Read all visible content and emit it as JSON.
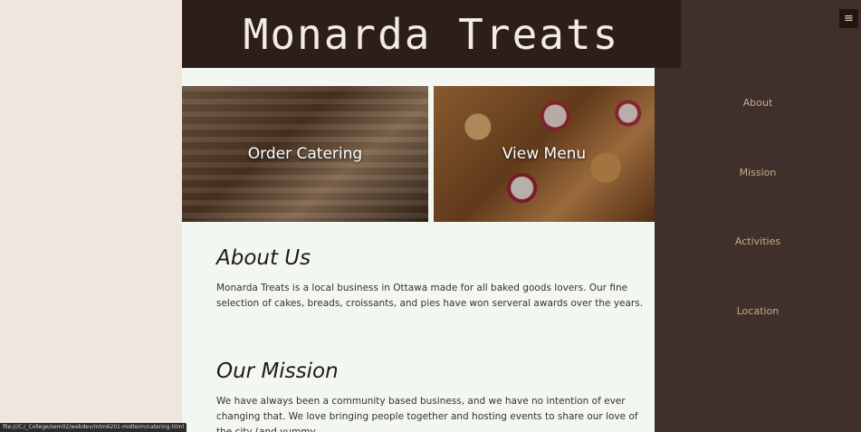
{
  "header": {
    "title": "Monarda Treats"
  },
  "tiles": [
    {
      "label": "Order Catering"
    },
    {
      "label": "View Menu"
    }
  ],
  "about": {
    "title": "About Us",
    "body": "Monarda Treats is a local business in Ottawa made for all baked goods lovers. Our fine selection of cakes, breads, croissants, and pies have won serveral awards over the years."
  },
  "mission": {
    "title": "Our Mission",
    "body": "We have always been a community based business, and we have no intention of ever changing that. We love bringing people together and hosting events to share our love of the city (and yummy"
  },
  "nav": {
    "menu_icon": "≡",
    "items": [
      "About",
      "Mission",
      "Activities",
      "Location"
    ]
  },
  "status": {
    "url": "file:///C:/_College/sem02/webdev/mtm6201-midterm/catering.html"
  }
}
